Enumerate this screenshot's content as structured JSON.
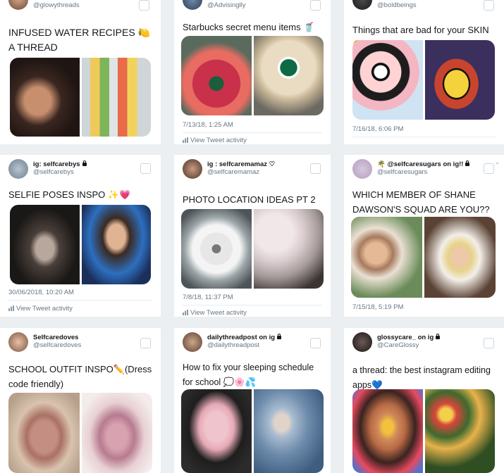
{
  "cards": [
    {
      "name": "",
      "handle": "@glowythreads",
      "text": "INFUSED WATER RECIPES 🍋 A THREAD",
      "timestamp": "",
      "activity": ""
    },
    {
      "name": "",
      "handle": "@Advisinglly",
      "text": "Starbucks secret menu items 🥤😊",
      "timestamp": "7/13/18, 1:25 AM",
      "activity": "View Tweet activity"
    },
    {
      "name": "",
      "handle": "@boldbeings",
      "text": "Things that are bad for your SKIN😳",
      "timestamp": "7/16/18, 6:06 PM",
      "activity": ""
    },
    {
      "name": "ig: selfcarebys",
      "handle": "@selfcarebys",
      "text": "SELFIE POSES INSPO ✨💗",
      "timestamp": "30/06/2018, 10:20 AM",
      "activity": "View Tweet activity"
    },
    {
      "name": "ig : selfcaremamaz ♡",
      "handle": "@selfcaremamaz",
      "text": "PHOTO LOCATION IDEAS PT 2 📸",
      "timestamp": "7/8/18, 11:37 PM",
      "activity": "View Tweet activity"
    },
    {
      "name": "🌴 @selfcaresugars on ig!!",
      "handle": "@selfcaresugars",
      "text": "WHICH MEMBER OF SHANE DAWSON'S SQUAD ARE YOU??",
      "timestamp": "7/15/18, 5:19 PM",
      "activity": ""
    },
    {
      "name": "Selfcaredoves",
      "handle": "@selfcaredoves",
      "text": "SCHOOL OUTFIT INSPO✏️(Dress code friendly)",
      "timestamp": "",
      "activity": ""
    },
    {
      "name": "dailythreadpost on ig",
      "handle": "@dailythreadpost",
      "text": "How to fix your sleeping schedule for school 💭🌸💦",
      "timestamp": "",
      "activity": ""
    },
    {
      "name": "glossycare_ on ig",
      "handle": "@CareGlossy",
      "text": "a thread: the best instagram editing apps💙",
      "timestamp": "",
      "activity": ""
    }
  ],
  "icons": {
    "checkbox": "checkbox-icon",
    "chevron": "chevron-down-icon",
    "lock": "lock-icon",
    "activity": "bar-chart-icon"
  },
  "colors": {
    "handle": "#657786",
    "border": "#ccd6dd",
    "background": "#eceff1"
  }
}
